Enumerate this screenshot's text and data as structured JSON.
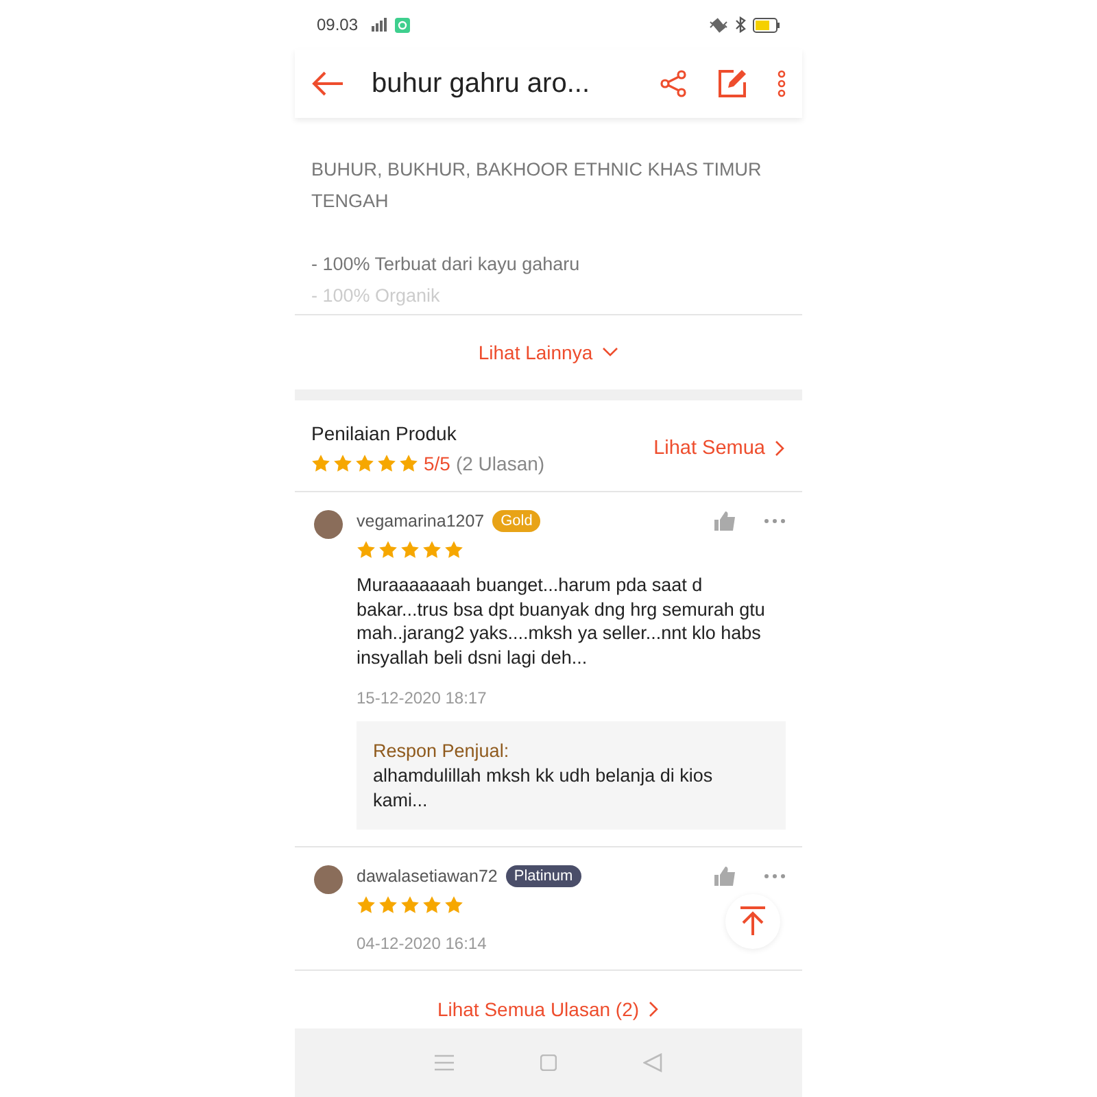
{
  "status_bar": {
    "time": "09.03"
  },
  "header": {
    "title": "buhur gahru aro..."
  },
  "description": {
    "paragraphs": [
      [
        "BUHUR, BUKHUR, BAKHOOR ETHNIC KHAS TIMUR TENGAH"
      ],
      [
        "- 100% Terbuat dari kayu gaharu",
        "- 100% Organik"
      ]
    ],
    "more_link": "Lihat Lainnya"
  },
  "ratings": {
    "title": "Penilaian Produk",
    "stars": 5,
    "score": "5/5",
    "count": "(2 Ulasan)",
    "see_all": "Lihat Semua"
  },
  "reviews": [
    {
      "user": "vegamarina1207",
      "tier": "Gold",
      "color": "#e8a317",
      "stars": 5,
      "text": "Muraaaaaaah buanget...harum pda saat d bakar...trus bsa dpt buanyak dng hrg semurah gtu mah..jarang2 yaks....mksh ya seller...nnt klo habs insyallah beli dsni lagi deh...",
      "date": "15-12-2020 18:17",
      "reply": {
        "label": "Respon Penjual:",
        "text": "alhamdulillah mksh kk udh belanja di kios kami..."
      }
    },
    {
      "user": "dawalasetiawan72",
      "tier": "Platinum",
      "color": "#4a4e69",
      "stars": 5,
      "date": "04-12-2020 16:14"
    }
  ],
  "all_reviews_link": "Lihat Semua Ulasan (2)"
}
